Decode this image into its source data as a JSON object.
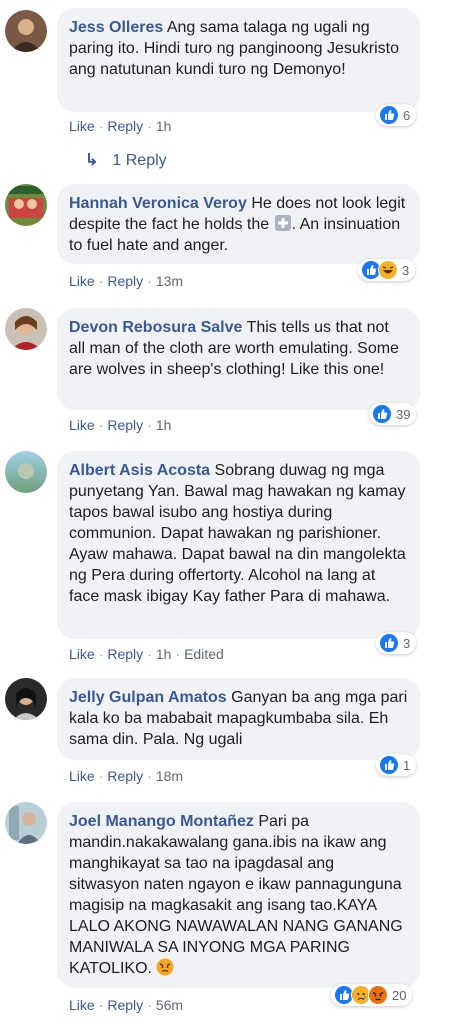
{
  "comments": [
    {
      "author": "Jess Olleres",
      "text": "Ang sama talaga ng ugali ng paring ito. Hindi turo ng panginoong Jesukristo ang natutunan kundi turo ng Demonyo!",
      "like": "Like",
      "reply": "Reply",
      "time": "1h",
      "reaction_count": "6",
      "reactions": [
        "like-icon"
      ]
    },
    {
      "author": "Hannah Veronica Veroy",
      "text_before": "He does not look legit despite the fact he holds the",
      "text_after": ". An insinuation to fuel hate and anger.",
      "like": "Like",
      "reply": "Reply",
      "time": "13m",
      "reaction_count": "3",
      "reactions": [
        "like-icon",
        "haha-icon"
      ]
    },
    {
      "author": "Devon Rebosura Salve",
      "text": "This tells us that not all man of the cloth are worth emulating. Some are wolves in sheep's clothing! Like this one!",
      "like": "Like",
      "reply": "Reply",
      "time": "1h",
      "reaction_count": "39",
      "reactions": [
        "like-icon"
      ]
    },
    {
      "author": "Albert Asis Acosta",
      "text": "Sobrang duwag ng mga punyetang Yan. Bawal mag hawakan ng kamay tapos bawal isubo ang hostiya during communion. Dapat hawakan ng parishioner. Ayaw mahawa. Dapat bawal na din mangolekta ng Pera during offertorty. Alcohol na lang at face mask ibigay Kay father Para di mahawa.",
      "like": "Like",
      "reply": "Reply",
      "time": "1h",
      "edited": "Edited",
      "reaction_count": "3",
      "reactions": [
        "like-icon"
      ]
    },
    {
      "author": "Jelly Gulpan Amatos",
      "text": "Ganyan ba ang mga pari kala ko ba mababait mapagkumbaba sila. Eh sama din. Pala. Ng ugali",
      "like": "Like",
      "reply": "Reply",
      "time": "18m",
      "reaction_count": "1",
      "reactions": [
        "like-icon"
      ]
    },
    {
      "author": "Joel Manango Montañez",
      "text": "Pari pa mandin.nakakawalang gana.ibis na ikaw ang manghikayat sa tao na ipagdasal ang sitwasyon naten ngayon e ikaw pannagunguna magisip na magkasakit ang isang tao.KAYA LALO AKONG NAWAWALAN NANG GANANG MANIWALA SA INYONG MGA PARING KATOLIKO.",
      "like": "Like",
      "reply": "Reply",
      "time": "56m",
      "reaction_count": "20",
      "reactions": [
        "like-icon",
        "sad-icon",
        "angry-icon"
      ]
    }
  ],
  "view_replies": "1 Reply",
  "colors": {
    "link": "#385898",
    "bubble": "#f0f2f5",
    "meta": "#606770",
    "like_blue": "#1877f2"
  }
}
